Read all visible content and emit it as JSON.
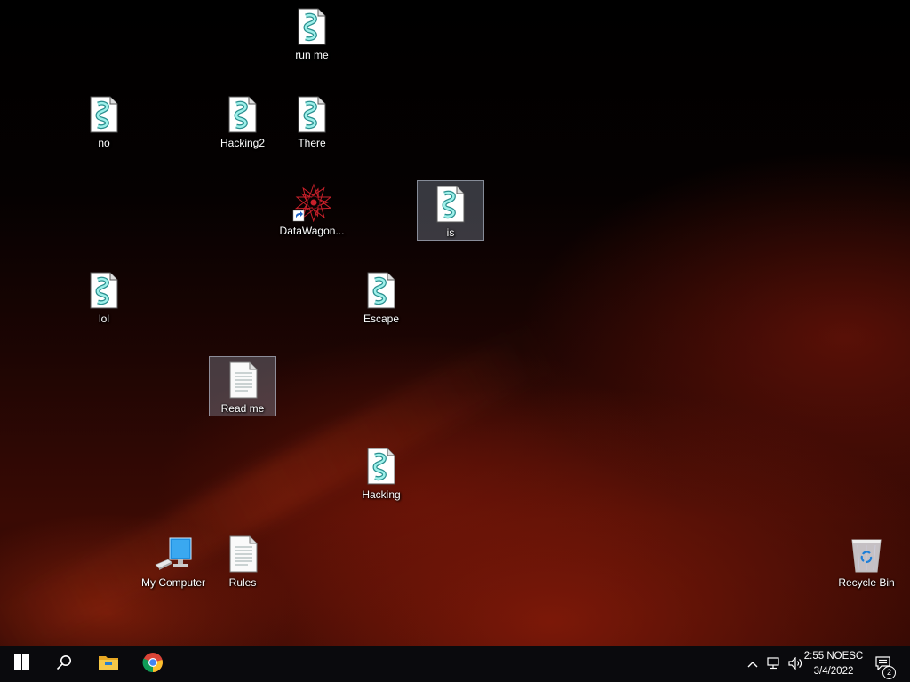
{
  "desktop": {
    "icons": {
      "run_me": {
        "label": "run me",
        "type": "script-icon"
      },
      "no": {
        "label": "no",
        "type": "script-icon"
      },
      "hacking2": {
        "label": "Hacking2",
        "type": "script-icon"
      },
      "there": {
        "label": "There",
        "type": "script-icon"
      },
      "datawagon": {
        "label": "DataWagon...",
        "type": "shortcut-starburst-icon"
      },
      "is": {
        "label": "is",
        "type": "script-icon",
        "selected": true
      },
      "lol": {
        "label": "lol",
        "type": "script-icon"
      },
      "escape": {
        "label": "Escape",
        "type": "script-icon"
      },
      "read_me": {
        "label": "Read me",
        "type": "text-document-icon",
        "selected": true
      },
      "hacking": {
        "label": "Hacking",
        "type": "script-icon"
      },
      "my_computer": {
        "label": "My Computer",
        "type": "computer-icon"
      },
      "rules": {
        "label": "Rules",
        "type": "text-document-icon"
      },
      "recycle_bin": {
        "label": "Recycle Bin",
        "type": "recycle-bin-icon"
      }
    }
  },
  "taskbar": {
    "start": "windows-start-icon",
    "search": "search-icon",
    "pinned": [
      "file-explorer-icon",
      "chrome-icon"
    ],
    "tray": {
      "overflow": "chevron-up-icon",
      "network": "network-icon",
      "volume": "volume-icon",
      "time": "2:55 NOESC",
      "date": "3/4/2022",
      "notifications_count": "2"
    }
  },
  "colors": {
    "taskbar": "#0a0a0d",
    "selection": "#96a0b4"
  }
}
